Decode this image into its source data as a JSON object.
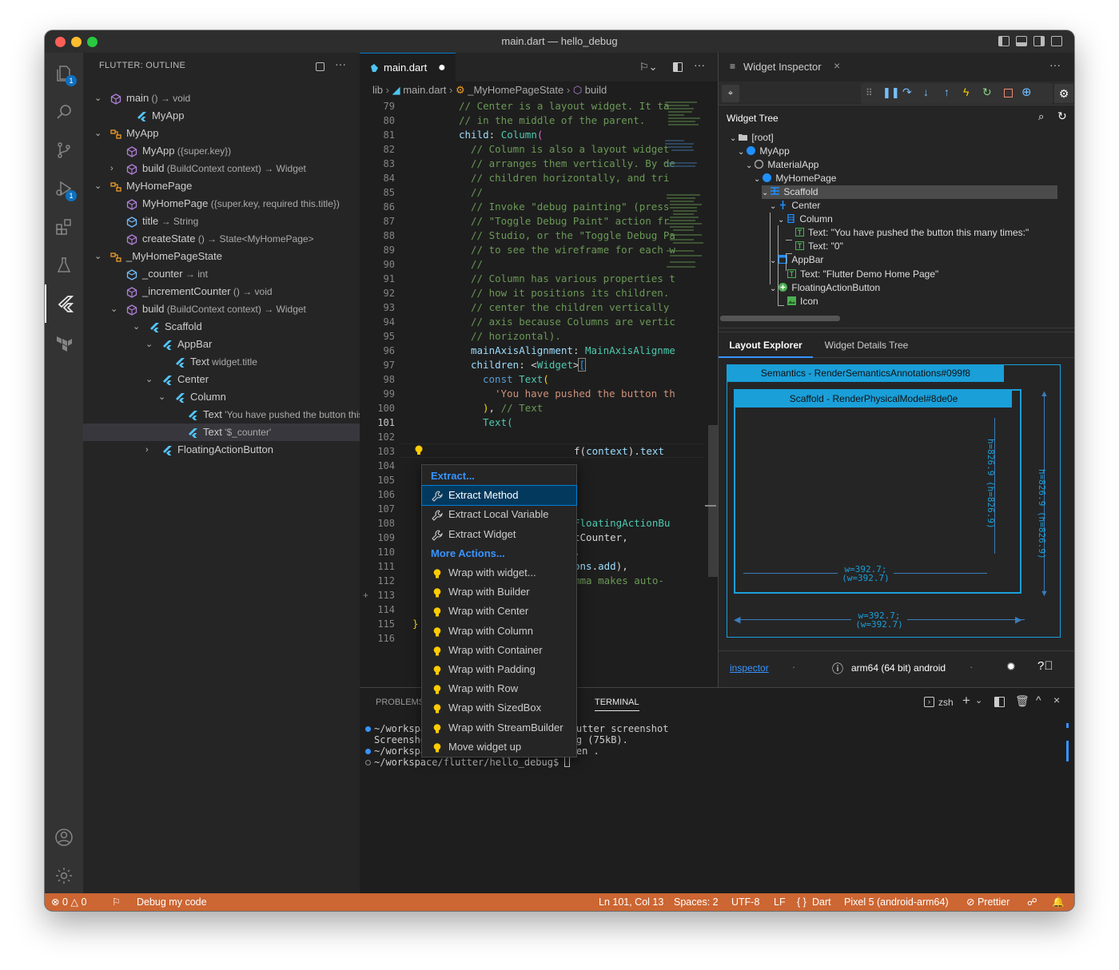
{
  "window": {
    "title": "main.dart — hello_debug"
  },
  "activity": {
    "explorer_badge": "1",
    "debug_badge": "1"
  },
  "outline": {
    "title": "FLUTTER: OUTLINE",
    "rows": [
      {
        "label": "main",
        "detail": "() → void",
        "kind": "method",
        "depth": 0,
        "chev": "down"
      },
      {
        "label": "MyApp",
        "detail": "",
        "kind": "flutter",
        "depth": 1,
        "chev": ""
      },
      {
        "label": "MyApp",
        "detail": "",
        "kind": "class",
        "depth": 0,
        "chev": "down"
      },
      {
        "label": "MyApp",
        "detail": "({super.key})",
        "kind": "method",
        "depth": 1,
        "chev": ""
      },
      {
        "label": "build",
        "detail": "(BuildContext context) → Widget",
        "kind": "method",
        "depth": 1,
        "chev": "right"
      },
      {
        "label": "MyHomePage",
        "detail": "",
        "kind": "class",
        "depth": 0,
        "chev": "down"
      },
      {
        "label": "MyHomePage",
        "detail": "({super.key, required this.title})",
        "kind": "method",
        "depth": 1,
        "chev": ""
      },
      {
        "label": "title",
        "detail": "→ String",
        "kind": "field",
        "depth": 1,
        "chev": ""
      },
      {
        "label": "createState",
        "detail": "() → State<MyHomePage>",
        "kind": "method",
        "depth": 1,
        "chev": ""
      },
      {
        "label": "_MyHomePageState",
        "detail": "",
        "kind": "class",
        "depth": 0,
        "chev": "down"
      },
      {
        "label": "_counter",
        "detail": "→ int",
        "kind": "field",
        "depth": 1,
        "chev": ""
      },
      {
        "label": "_incrementCounter",
        "detail": "() → void",
        "kind": "method",
        "depth": 1,
        "chev": ""
      },
      {
        "label": "build",
        "detail": "(BuildContext context) → Widget",
        "kind": "method",
        "depth": 1,
        "chev": "down"
      },
      {
        "label": "Scaffold",
        "detail": "",
        "kind": "flutter",
        "depth": 2,
        "chev": "down"
      },
      {
        "label": "AppBar",
        "detail": "",
        "kind": "flutter",
        "depth": 3,
        "chev": "down"
      },
      {
        "label": "Text",
        "detail": "widget.title",
        "kind": "flutter",
        "depth": 4,
        "chev": ""
      },
      {
        "label": "Center",
        "detail": "",
        "kind": "flutter",
        "depth": 3,
        "chev": "down"
      },
      {
        "label": "Column",
        "detail": "",
        "kind": "flutter",
        "depth": 4,
        "chev": "down"
      },
      {
        "label": "Text",
        "detail": "'You have pushed the button this ...",
        "kind": "flutter",
        "depth": 5,
        "chev": ""
      },
      {
        "label": "Text",
        "detail": "'$_counter'",
        "kind": "flutter",
        "depth": 5,
        "chev": "",
        "selected": true
      },
      {
        "label": "FloatingActionButton",
        "detail": "",
        "kind": "flutter",
        "depth": 3,
        "chev": "right"
      }
    ]
  },
  "editor": {
    "tab": "main.dart",
    "breadcrumb": [
      "lib",
      "main.dart",
      "_MyHomePageState",
      "build"
    ],
    "current_line": "101",
    "lines": [
      {
        "n": "79",
        "t": "// Center is a layout widget. It ta",
        "c": "cm",
        "ind": 0
      },
      {
        "n": "80",
        "t": "// in the middle of the parent.",
        "c": "cm",
        "ind": 0
      },
      {
        "n": "81",
        "t": "child: Column(",
        "c": "mix1",
        "ind": 0
      },
      {
        "n": "82",
        "t": "// Column is also a layout widget",
        "c": "cm",
        "ind": 1
      },
      {
        "n": "83",
        "t": "// arranges them vertically. By de",
        "c": "cm",
        "ind": 1
      },
      {
        "n": "84",
        "t": "// children horizontally, and tri",
        "c": "cm",
        "ind": 1
      },
      {
        "n": "85",
        "t": "//",
        "c": "cm",
        "ind": 1
      },
      {
        "n": "86",
        "t": "// Invoke \"debug painting\" (press",
        "c": "cm",
        "ind": 1
      },
      {
        "n": "87",
        "t": "// \"Toggle Debug Paint\" action fr",
        "c": "cm",
        "ind": 1
      },
      {
        "n": "88",
        "t": "// Studio, or the \"Toggle Debug Pa",
        "c": "cm",
        "ind": 1
      },
      {
        "n": "89",
        "t": "// to see the wireframe for each w",
        "c": "cm",
        "ind": 1
      },
      {
        "n": "90",
        "t": "//",
        "c": "cm",
        "ind": 1
      },
      {
        "n": "91",
        "t": "// Column has various properties t",
        "c": "cm",
        "ind": 1
      },
      {
        "n": "92",
        "t": "// how it positions its children.",
        "c": "cm",
        "ind": 1
      },
      {
        "n": "93",
        "t": "// center the children vertically",
        "c": "cm",
        "ind": 1
      },
      {
        "n": "94",
        "t": "// axis because Columns are vertic",
        "c": "cm",
        "ind": 1
      },
      {
        "n": "95",
        "t": "// horizontal).",
        "c": "cm",
        "ind": 1
      },
      {
        "n": "96",
        "t": "mainAxisAlignment: MainAxisAlignme",
        "c": "mix2",
        "ind": 1
      },
      {
        "n": "97",
        "t": "children: <Widget>[",
        "c": "mix3",
        "ind": 1
      },
      {
        "n": "98",
        "t": "const Text(",
        "c": "mix4",
        "ind": 2
      },
      {
        "n": "99",
        "t": "'You have pushed the button th",
        "c": "st",
        "ind": 3
      },
      {
        "n": "100",
        "t": "), // Text",
        "c": "mix5",
        "ind": 2
      },
      {
        "n": "101",
        "t": "Text(",
        "c": "ty",
        "ind": 2
      },
      {
        "n": "102",
        "t": "",
        "c": "",
        "ind": 0
      },
      {
        "n": "103",
        "t": "f(context).text",
        "c": "mix6",
        "ind": 0
      },
      {
        "n": "104",
        "t": "",
        "c": "",
        "ind": 0
      },
      {
        "n": "105",
        "t": "",
        "c": "",
        "ind": 0
      },
      {
        "n": "106",
        "t": "",
        "c": "",
        "ind": 0
      },
      {
        "n": "107",
        "t": "",
        "c": "",
        "ind": 0
      },
      {
        "n": "108",
        "t": "FloatingActionBu",
        "c": "ty",
        "ind": 0
      },
      {
        "n": "109",
        "t": "tCounter,",
        "c": "pl",
        "ind": 0
      },
      {
        "n": "110",
        "t": ",",
        "c": "pl",
        "ind": 0
      },
      {
        "n": "111",
        "t": "ons.add),",
        "c": "mix7",
        "ind": 0
      },
      {
        "n": "112",
        "t": "mma makes auto-",
        "c": "cm",
        "ind": 0
      },
      {
        "n": "113",
        "t": "",
        "c": "",
        "ind": 0
      },
      {
        "n": "114",
        "t": "",
        "c": "",
        "ind": 0
      },
      {
        "n": "115",
        "t": "}",
        "c": "br",
        "ind": 0
      },
      {
        "n": "116",
        "t": "",
        "c": "",
        "ind": 0
      }
    ]
  },
  "context_menu": {
    "items": [
      {
        "label": "Extract...",
        "type": "header"
      },
      {
        "label": "Extract Method",
        "type": "wrench",
        "selected": true
      },
      {
        "label": "Extract Local Variable",
        "type": "wrench"
      },
      {
        "label": "Extract Widget",
        "type": "wrench"
      },
      {
        "label": "More Actions...",
        "type": "header"
      },
      {
        "label": "Wrap with widget...",
        "type": "bulb"
      },
      {
        "label": "Wrap with Builder",
        "type": "bulb"
      },
      {
        "label": "Wrap with Center",
        "type": "bulb"
      },
      {
        "label": "Wrap with Column",
        "type": "bulb"
      },
      {
        "label": "Wrap with Container",
        "type": "bulb"
      },
      {
        "label": "Wrap with Padding",
        "type": "bulb"
      },
      {
        "label": "Wrap with Row",
        "type": "bulb"
      },
      {
        "label": "Wrap with SizedBox",
        "type": "bulb"
      },
      {
        "label": "Wrap with StreamBuilder",
        "type": "bulb"
      },
      {
        "label": "Move widget up",
        "type": "bulb"
      }
    ]
  },
  "inspector": {
    "tab": "Widget Inspector",
    "tree_title": "Widget Tree",
    "tree": [
      {
        "label": "[root]",
        "icon": "folder",
        "depth": 0,
        "chev": true
      },
      {
        "label": "MyApp",
        "icon": "circle-blue",
        "depth": 1,
        "chev": true
      },
      {
        "label": "MaterialApp",
        "icon": "circle-gray",
        "depth": 2,
        "chev": true
      },
      {
        "label": "MyHomePage",
        "icon": "circle-blue",
        "depth": 3,
        "chev": true
      },
      {
        "label": "Scaffold",
        "icon": "scaffold",
        "depth": 4,
        "chev": true,
        "selected": true
      },
      {
        "label": "Center",
        "icon": "center",
        "depth": 5,
        "chev": true
      },
      {
        "label": "Column",
        "icon": "column",
        "depth": 6,
        "chev": true
      },
      {
        "label": "Text: \"You have pushed the button this many times:\"",
        "icon": "text",
        "depth": 7,
        "chev": false
      },
      {
        "label": "Text: \"0\"",
        "icon": "text",
        "depth": 7,
        "chev": false
      },
      {
        "label": "AppBar",
        "icon": "appbar",
        "depth": 5,
        "chev": true
      },
      {
        "label": "Text: \"Flutter Demo Home Page\"",
        "icon": "text",
        "depth": 6,
        "chev": false
      },
      {
        "label": "FloatingActionButton",
        "icon": "fab",
        "depth": 5,
        "chev": true
      },
      {
        "label": "Icon",
        "icon": "image",
        "depth": 6,
        "chev": false
      }
    ],
    "subtabs": [
      "Layout Explorer",
      "Widget Details Tree"
    ],
    "outer_box": "Semantics - RenderSemanticsAnnotations#099f8",
    "inner_box": "Scaffold - RenderPhysicalModel#8de0e",
    "inner_w": "w=392.7;",
    "inner_w2": "(w=392.7)",
    "inner_h": "h=826.9",
    "inner_h2": "(h=826.9)",
    "outer_w": "w=392.7;",
    "outer_w2": "(w=392.7)",
    "outer_h": "h=826.9",
    "outer_h2": "(h=826.9)",
    "footer_link": "inspector",
    "footer_device": "arm64 (64 bit) android"
  },
  "panel": {
    "tabs": [
      "PROBLEMS",
      "TERMINAL"
    ],
    "shell": "zsh",
    "lines": [
      {
        "t": "~/workspace/flutter/hello_debug$ flutter screenshot",
        "dot": "blue"
      },
      {
        "t": "Screenshot written to flutter_01.png (75kB).",
        "dot": ""
      },
      {
        "t": "~/workspace/flutter/hello_debug$ open .",
        "dot": "blue"
      },
      {
        "t": "~/workspace/flutter/hello_debug$ ",
        "dot": "hollow"
      }
    ]
  },
  "status": {
    "errors": "0",
    "warnings": "0",
    "debug": "Debug my code",
    "position": "Ln 101, Col 13",
    "spaces": "Spaces: 2",
    "encoding": "UTF-8",
    "eol": "LF",
    "language": "Dart",
    "device": "Pixel 5 (android-arm64)",
    "prettier": "Prettier"
  },
  "colors": {
    "statusbar": "#cc6633",
    "accent": "#007acc",
    "selection": "#04395e",
    "layout_blue": "#1a9fd9"
  }
}
